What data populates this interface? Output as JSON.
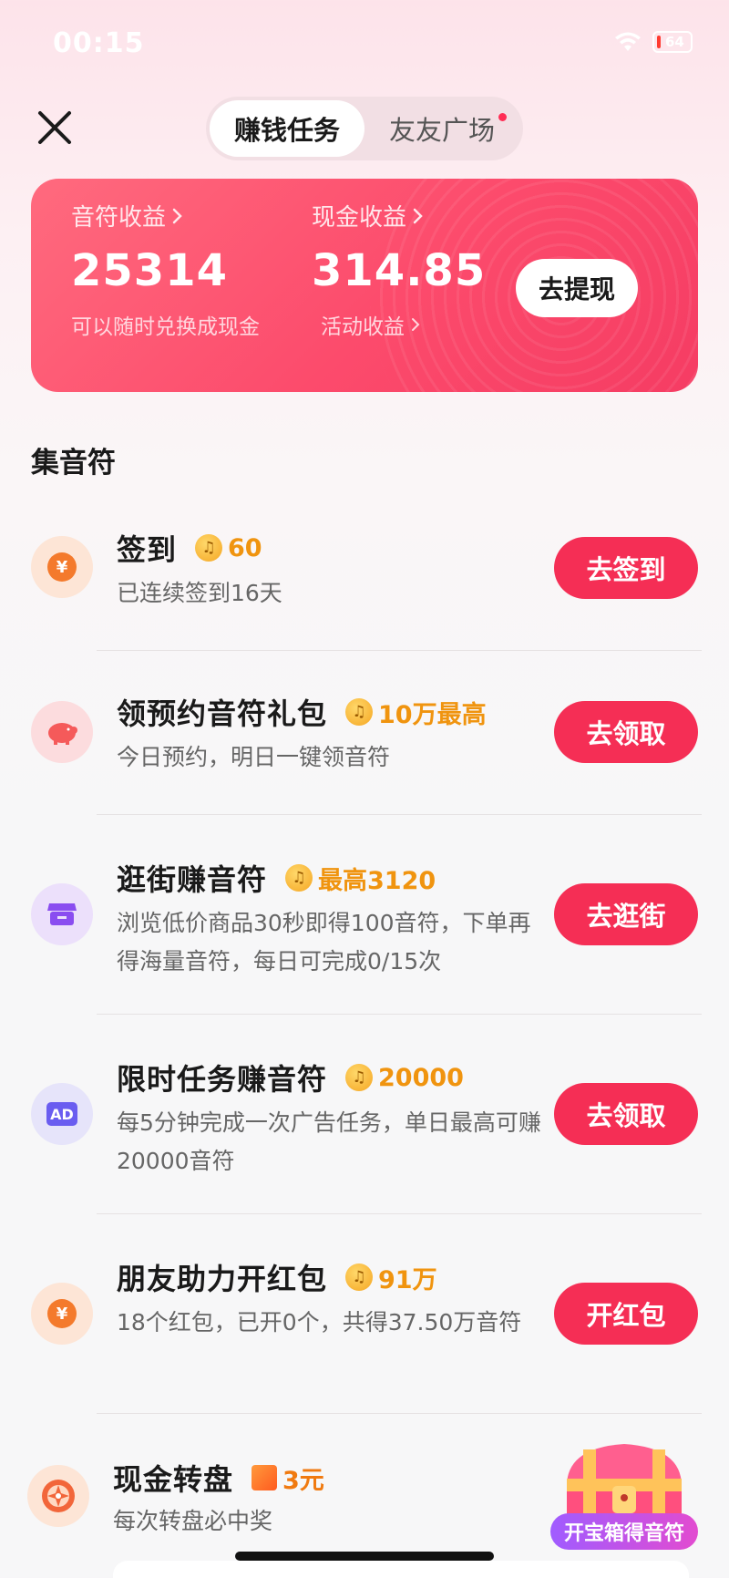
{
  "status_bar": {
    "time": "00:15",
    "battery": "64"
  },
  "header": {
    "tabs": [
      {
        "label": "赚钱任务",
        "active": true
      },
      {
        "label": "友友广场",
        "active": false,
        "has_dot": true
      }
    ]
  },
  "earnings": {
    "note_label": "音符收益",
    "note_value": "25314",
    "note_sub": "可以随时兑换成现金",
    "cash_label": "现金收益",
    "cash_value": "314.85",
    "cash_sub": "活动收益",
    "withdraw_label": "去提现"
  },
  "section_title": "集音符",
  "tasks": [
    {
      "title": "签到",
      "reward": "60",
      "desc": "已连续签到16天",
      "button": "去签到",
      "icon": "yen-coin-icon"
    },
    {
      "title": "领预约音符礼包",
      "reward": "10万最高",
      "desc": "今日预约，明日一键领音符",
      "button": "去领取",
      "icon": "piggy-bank-icon"
    },
    {
      "title": "逛街赚音符",
      "reward": "最高3120",
      "desc": "浏览低价商品30秒即得100音符，下单再得海量音符，每日可完成0/15次",
      "button": "去逛街",
      "icon": "store-icon"
    },
    {
      "title": "限时任务赚音符",
      "reward": "20000",
      "desc": "每5分钟完成一次广告任务，单日最高可赚20000音符",
      "button": "去领取",
      "icon": "ad-icon",
      "icon_text": "AD"
    },
    {
      "title": "朋友助力开红包",
      "reward": "91万",
      "desc": "18个红包，已开0个，共得37.50万音符",
      "button": "开红包",
      "icon": "yen-coin-icon"
    },
    {
      "title": "现金转盘",
      "reward": "3元",
      "desc": "每次转盘必中奖",
      "icon": "wheel-icon"
    }
  ],
  "treasure": {
    "label": "开宝箱得音符"
  },
  "colors": {
    "accent": "#f52e55",
    "reward": "#f0940f",
    "card": "#fc4b6c"
  }
}
